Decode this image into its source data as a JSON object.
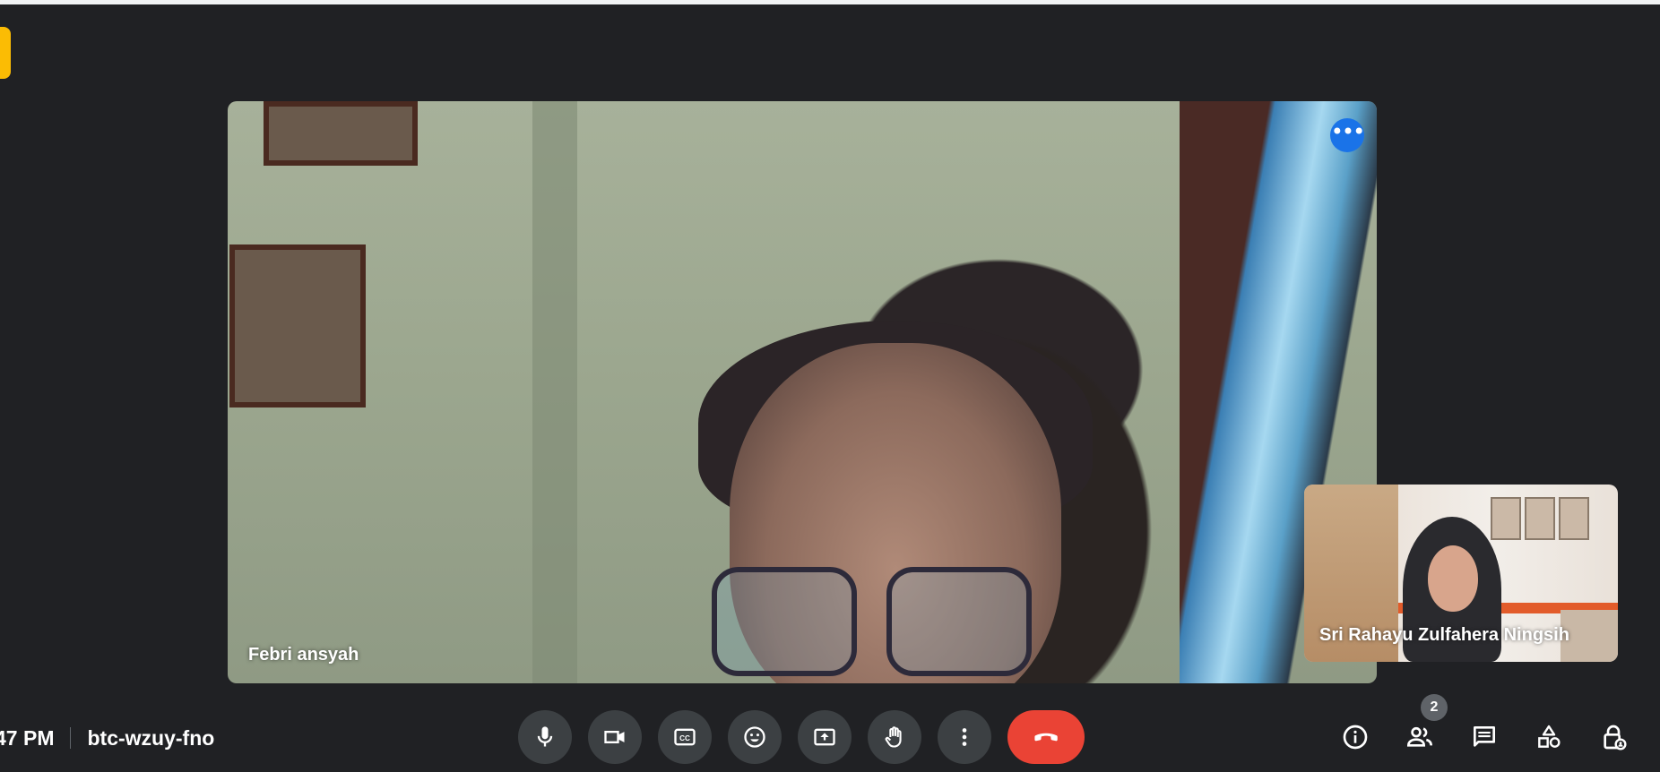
{
  "meeting": {
    "time_partial": "47 PM",
    "code": "btc-wzuy-fno"
  },
  "main_participant": {
    "name": "Febri ansyah"
  },
  "pip_participant": {
    "name": "Sri Rahayu Zulfahera Ningsih"
  },
  "participants_count": "2",
  "controls": [
    {
      "name": "microphone",
      "icon": "mic-icon"
    },
    {
      "name": "camera",
      "icon": "videocam-icon"
    },
    {
      "name": "captions",
      "icon": "closed-captions-icon"
    },
    {
      "name": "reactions",
      "icon": "emoji-icon"
    },
    {
      "name": "present",
      "icon": "present-screen-icon"
    },
    {
      "name": "raise-hand",
      "icon": "hand-icon"
    },
    {
      "name": "more-options",
      "icon": "more-vert-icon"
    },
    {
      "name": "leave-call",
      "icon": "call-end-icon"
    }
  ],
  "right_panel_icons": [
    "info-icon",
    "people-icon",
    "chat-icon",
    "activities-icon",
    "host-controls-icon"
  ],
  "colors": {
    "background": "#202124",
    "control_button": "#3c4043",
    "end_call": "#ea4335",
    "accent_blue": "#1a73e8",
    "tab_yellow": "#fbbc04"
  }
}
